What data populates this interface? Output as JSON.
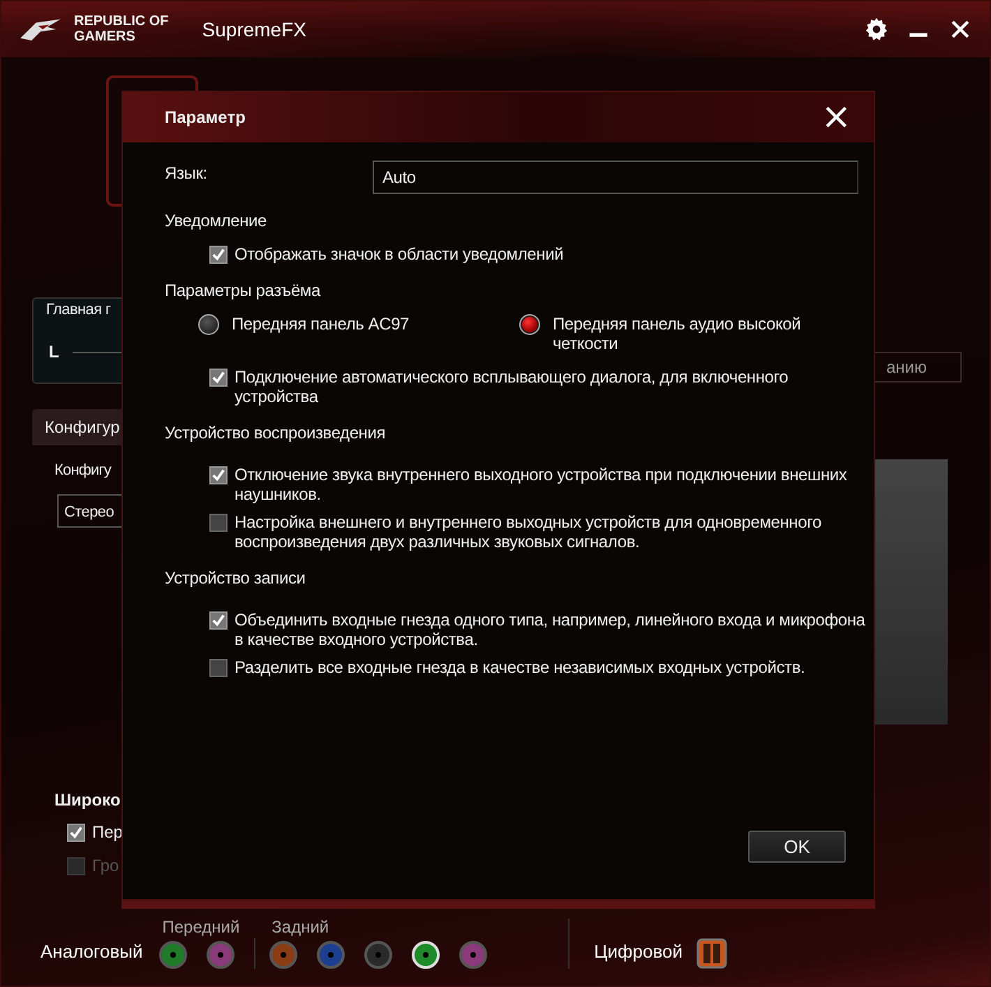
{
  "app": {
    "logo_line1": "REPUBLIC OF",
    "logo_line2": "GAMERS",
    "title": "SupremeFX"
  },
  "background": {
    "group_title": "Главная г",
    "channel": "L",
    "tab": "Конфигур",
    "config_label": "Конфигу",
    "config_value": "Стерео",
    "side_button": "анию",
    "section": "Широко",
    "checks": [
      {
        "label": "Пер",
        "checked": true,
        "disabled": false
      },
      {
        "label": "Гро",
        "checked": false,
        "disabled": true
      }
    ]
  },
  "dialog": {
    "title": "Параметр",
    "close": "×",
    "language_label": "Язык:",
    "language_value": "Auto",
    "sections": [
      {
        "title": "Уведомление",
        "items": [
          {
            "kind": "checkbox",
            "label": "Отображать значок в области уведомлений",
            "checked": true
          }
        ]
      },
      {
        "title": "Параметры разъёма",
        "items": [
          {
            "kind": "radios",
            "options": [
              {
                "label": "Передняя панель AC97",
                "selected": false
              },
              {
                "label": "Передняя панель аудио высокой четкости",
                "selected": true
              }
            ]
          },
          {
            "kind": "checkbox",
            "label": "Подключение автоматического всплывающего диалога, для включенного устройства",
            "checked": true
          }
        ]
      },
      {
        "title": "Устройство воспроизведения",
        "items": [
          {
            "kind": "checkbox",
            "label": "Отключение звука внутреннего выходного устройства при подключении внешних наушников.",
            "checked": true
          },
          {
            "kind": "checkbox",
            "label": "Настройка внешнего и внутреннего выходных устройств для одновременного воспроизведения двух различных звуковых сигналов.",
            "checked": false
          }
        ]
      },
      {
        "title": "Устройство записи",
        "items": [
          {
            "kind": "checkbox",
            "label": "Объединить входные гнезда одного типа, например, линейного входа и микрофона в качестве входного устройства.",
            "checked": true
          },
          {
            "kind": "checkbox",
            "label": "Разделить все входные гнезда в качестве независимых входных устройств.",
            "checked": false
          }
        ]
      }
    ],
    "ok": "OK"
  },
  "bottom_bar": {
    "analog_label": "Аналоговый",
    "front_label": "Передний",
    "rear_label": "Задний",
    "digital_label": "Цифровой",
    "front_jacks": [
      {
        "color": "#1f7a2a",
        "selected": false
      },
      {
        "color": "#8a3a78",
        "selected": false
      }
    ],
    "rear_jacks": [
      {
        "color": "#8a3d14",
        "selected": false
      },
      {
        "color": "#1d3f8f",
        "selected": false
      },
      {
        "color": "#2a2a2a",
        "selected": false
      },
      {
        "color": "#1f8a2a",
        "selected": true
      },
      {
        "color": "#8a3a78",
        "selected": false
      }
    ]
  }
}
